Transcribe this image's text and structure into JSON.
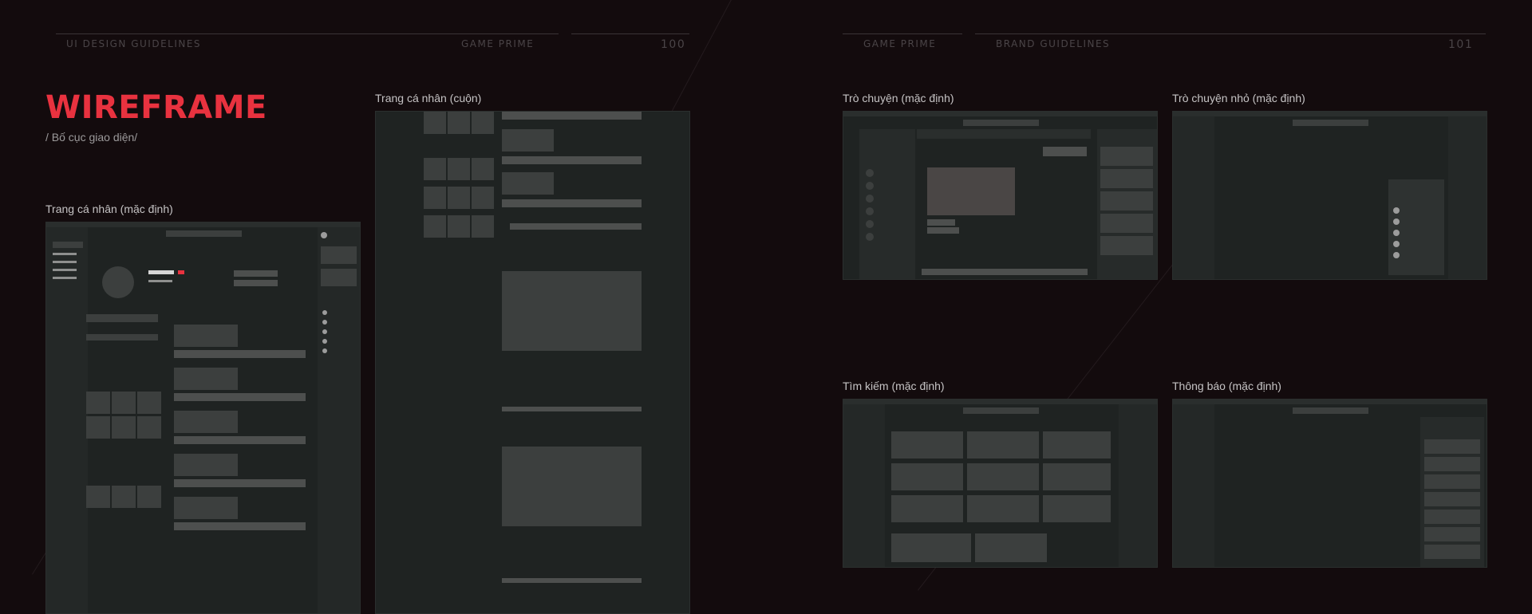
{
  "header_left": {
    "guide": "UI DESIGN GUIDELINES",
    "brand": "GAME PRIME",
    "page": "100"
  },
  "header_right": {
    "brand": "GAME PRIME",
    "guide": "BRAND GUIDELINES",
    "page": "101"
  },
  "title": "WIREFRAME",
  "subtitle": "/ Bố cục giao diện/",
  "wireframes": [
    {
      "label": "Trang cá nhân (mặc định)"
    },
    {
      "label": "Trang cá nhân (cuộn)"
    },
    {
      "label": "Trò chuyện (mặc định)"
    },
    {
      "label": "Trò chuyện nhỏ (mặc định)"
    },
    {
      "label": "Tìm kiếm (mặc định)"
    },
    {
      "label": "Thông báo (mặc định)"
    }
  ],
  "colors": {
    "background": "#130b0d",
    "accent": "#e8323f",
    "frame": "#1f2322",
    "block": "#3c3f3e"
  }
}
